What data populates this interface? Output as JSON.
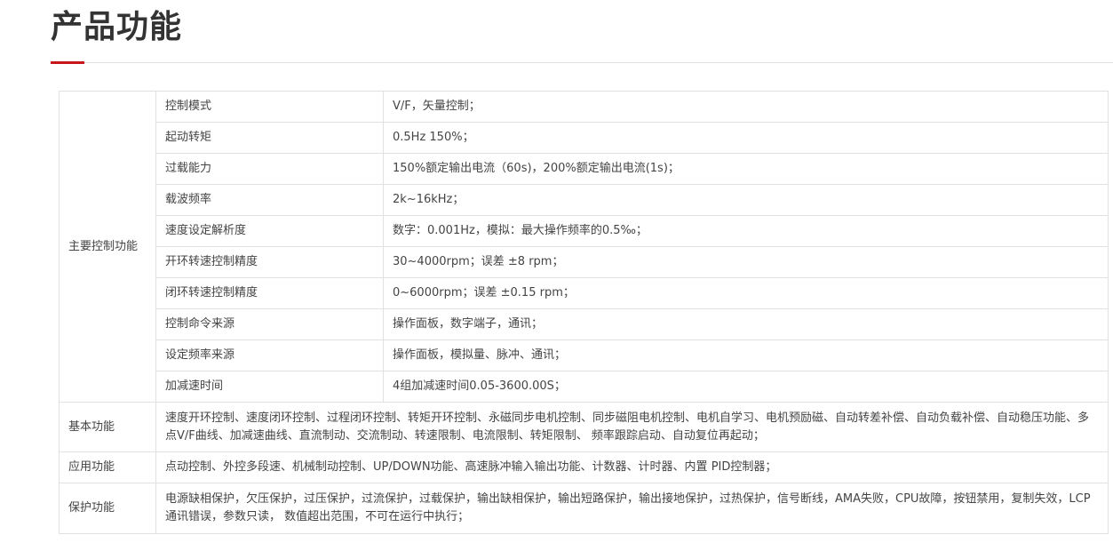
{
  "page": {
    "title": "产品功能"
  },
  "colors": {
    "accent": "#c8161d",
    "border": "#e1e1e1",
    "text": "#444444"
  },
  "table": {
    "main_control": {
      "category": "主要控制功能",
      "rows": [
        {
          "label": "控制模式",
          "value": "V/F，矢量控制；"
        },
        {
          "label": "起动转矩",
          "value": "0.5Hz 150%；"
        },
        {
          "label": "过载能力",
          "value": "150%额定输出电流（60s)，200%额定输出电流(1s)；"
        },
        {
          "label": "载波频率",
          "value": "2k~16kHz；"
        },
        {
          "label": "速度设定解析度",
          "value": "数字：0.001Hz，模拟：最大操作频率的0.5‰；"
        },
        {
          "label": "开环转速控制精度",
          "value": "30~4000rpm；误差 ±8 rpm；"
        },
        {
          "label": "闭环转速控制精度",
          "value": "0~6000rpm；误差 ±0.15 rpm；"
        },
        {
          "label": "控制命令来源",
          "value": "操作面板，数字端子，通讯；"
        },
        {
          "label": "设定频率来源",
          "value": "操作面板，模拟量、脉冲、通讯；"
        },
        {
          "label": "加减速时间",
          "value": "4组加减速时间0.05-3600.00S；"
        }
      ]
    },
    "basic": {
      "category": "基本功能",
      "value": "速度开环控制、速度闭环控制、过程闭环控制、转矩开环控制、永磁同步电机控制、同步磁阻电机控制、电机自学习、电机预励磁、自动转差补偿、自动负载补偿、自动稳压功能、多点V/F曲线、加减速曲线、直流制动、交流制动、转速限制、电流限制、转矩限制、 频率跟踪启动、自动复位再起动；"
    },
    "application": {
      "category": "应用功能",
      "value": "点动控制、外控多段速、机械制动控制、UP/DOWN功能、高速脉冲输入输出功能、计数器、计时器、内置 PID控制器；"
    },
    "protection": {
      "category": "保护功能",
      "value": "电源缺相保护，欠压保护，过压保护，过流保护，过载保护，输出缺相保护，输出短路保护，输出接地保护，过热保护，信号断线，AMA失败，CPU故障，按钮禁用，复制失效，LCP通讯错误，参数只读， 数值超出范围，不可在运行中执行；"
    }
  }
}
